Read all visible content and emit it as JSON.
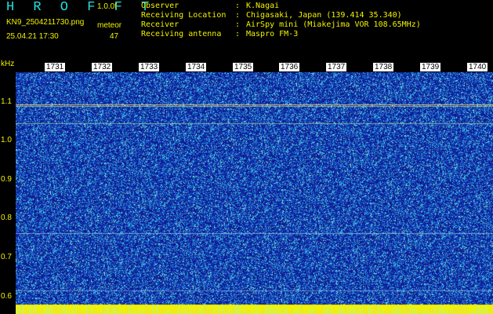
{
  "header": {
    "title": "H R O F F T",
    "version": "1.0.0f",
    "filename": "KN9_2504211730.png",
    "timestamp": "25.04.21 17:30",
    "meteor_label": "meteor",
    "meteor_count": "47",
    "info": [
      {
        "key": "Observer",
        "value": "K.Nagai"
      },
      {
        "key": "Receiving Location",
        "value": "Chigasaki, Japan (139.414 35.340)"
      },
      {
        "key": "Receiver",
        "value": "AirSpy mini (Miakejima VOR 108.65MHz)"
      },
      {
        "key": "Receiving antenna",
        "value": "Maspro FM-3"
      }
    ]
  },
  "spectrogram": {
    "y_unit": "kHz",
    "y_ticks": [
      "1.1",
      "1.0",
      "0.9",
      "0.8",
      "0.7",
      "0.6"
    ],
    "x_ticks": [
      "1731",
      "1732",
      "1733",
      "1734",
      "1735",
      "1736",
      "1737",
      "1738",
      "1739",
      "1740"
    ],
    "colors": {
      "background": "#1020a0",
      "noise_high": "#40e0f0",
      "marker": "#f2f200",
      "label_bg": "#ffffff"
    }
  }
}
